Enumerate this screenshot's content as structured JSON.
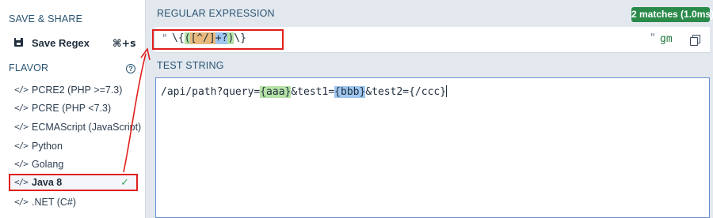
{
  "sidebar": {
    "save_share_title": "SAVE & SHARE",
    "save_label": "Save Regex",
    "save_shortcut": "⌘+s",
    "flavor_title": "FLAVOR",
    "help_icon": "?",
    "flavors": [
      {
        "icon": "</>",
        "label": "PCRE2 (PHP >=7.3)"
      },
      {
        "icon": "</>",
        "label": "PCRE (PHP <7.3)"
      },
      {
        "icon": "</>",
        "label": "ECMAScript (JavaScript)"
      },
      {
        "icon": "</>",
        "label": "Python"
      },
      {
        "icon": "</>",
        "label": "Golang"
      },
      {
        "icon": "</>",
        "label": "Java 8",
        "selected": true,
        "check": "✓"
      },
      {
        "icon": "</>",
        "label": ".NET (C#)"
      }
    ]
  },
  "regex": {
    "title": "REGULAR EXPRESSION",
    "match_badge": "2 matches (1.0ms)",
    "delimiter_open": "\"",
    "tokens": {
      "t1": "\\{",
      "t2": "(",
      "t3": "[^/]",
      "t4": "+?",
      "t5": ")",
      "t6": "\\}"
    },
    "delimiter_close": "\"",
    "flags": "gm"
  },
  "test": {
    "title": "TEST STRING",
    "segments": {
      "s1": "/api/path?query=",
      "s2": "{aaa}",
      "s3": "&test1=",
      "s4": "{bbb}",
      "s5": "&test2={/ccc}"
    }
  },
  "colors": {
    "highlight_border": "#e0201c",
    "group_match": "#b5e2a6",
    "char_set": "#e9b97c",
    "quantifier": "#9fc6ee",
    "badge_green": "#2a8a4a"
  }
}
